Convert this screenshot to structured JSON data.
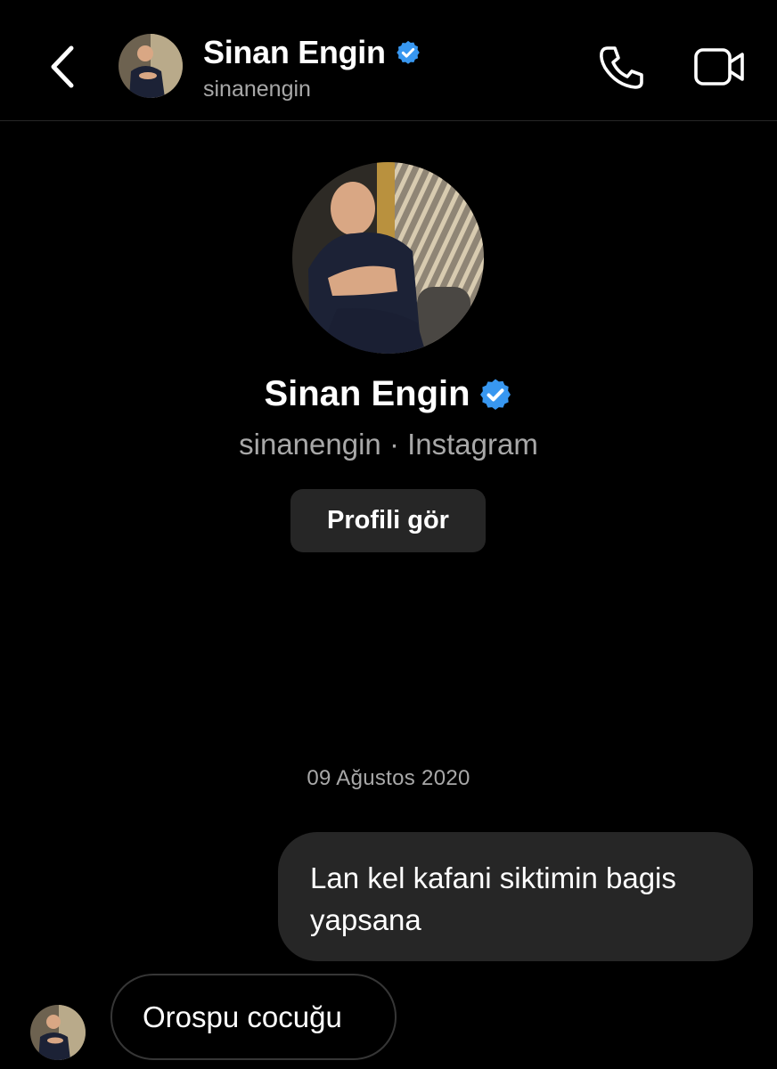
{
  "header": {
    "name": "Sinan Engin",
    "username": "sinanengin",
    "icons": [
      "back-icon",
      "verified-badge-icon",
      "phone-icon",
      "video-camera-icon"
    ]
  },
  "profile": {
    "name": "Sinan Engin",
    "subtitle": "sinanengin · Instagram",
    "view_profile_label": "Profili gör"
  },
  "conversation": {
    "date": "09 Ağustos 2020",
    "messages": [
      {
        "direction": "outgoing",
        "text": "Lan kel kafani siktimin bagis yapsana"
      },
      {
        "direction": "incoming",
        "text": "Orospu cocuğu"
      }
    ]
  },
  "colors": {
    "background": "#000000",
    "bubble": "#262626",
    "secondary_text": "#a8a8a8",
    "verified": "#3897f0"
  }
}
